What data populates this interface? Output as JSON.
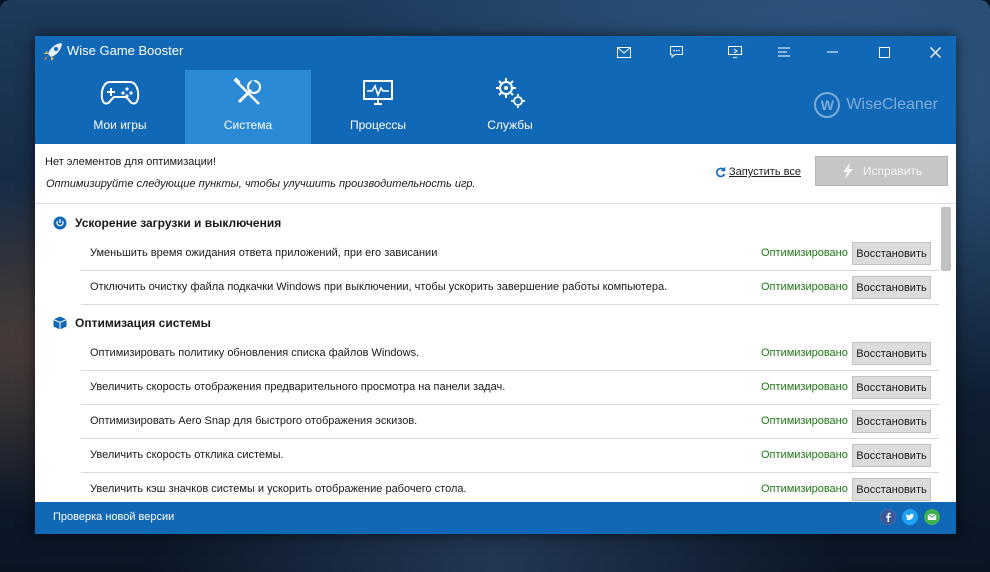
{
  "window": {
    "title": "Wise Game Booster"
  },
  "nav": {
    "tabs": [
      {
        "label": "Мои игры",
        "icon": "gamepad-icon"
      },
      {
        "label": "Система",
        "icon": "tools-icon"
      },
      {
        "label": "Процессы",
        "icon": "monitor-icon"
      },
      {
        "label": "Службы",
        "icon": "gears-icon"
      }
    ],
    "active_tab": "Система",
    "brand": "WiseCleaner",
    "brand_letter": "W"
  },
  "info": {
    "status": "Нет элементов для оптимизации!",
    "hint": "Оптимизируйте следующие пункты, чтобы улучшить производительность игр.",
    "run_all": "Запустить все",
    "fix_button": "Исправить"
  },
  "sections": [
    {
      "title": "Ускорение загрузки и выключения",
      "icon": "power-icon",
      "items": [
        {
          "text": "Уменьшить время ожидания ответа приложений, при его зависании",
          "state": "Оптимизировано",
          "action": "Восстановить"
        },
        {
          "text": "Отключить очистку файла подкачки Windows при выключении, чтобы ускорить завершение работы компьютера.",
          "state": "Оптимизировано",
          "action": "Восстановить"
        }
      ]
    },
    {
      "title": "Оптимизация системы",
      "icon": "cube-icon",
      "items": [
        {
          "text": "Оптимизировать политику обновления списка файлов Windows.",
          "state": "Оптимизировано",
          "action": "Восстановить"
        },
        {
          "text": "Увеличить скорость отображения предварительного просмотра на панели задач.",
          "state": "Оптимизировано",
          "action": "Восстановить"
        },
        {
          "text": "Оптимизировать Aero Snap для быстрого отображения эскизов.",
          "state": "Оптимизировано",
          "action": "Восстановить"
        },
        {
          "text": "Увеличить скорость отклика системы.",
          "state": "Оптимизировано",
          "action": "Восстановить"
        },
        {
          "text": "Увеличить кэш значков системы и ускорить отображение рабочего стола.",
          "state": "Оптимизировано",
          "action": "Восстановить"
        }
      ]
    }
  ],
  "footer": {
    "check_update": "Проверка новой версии",
    "social": [
      "facebook-icon",
      "twitter-icon",
      "email-icon"
    ]
  },
  "colors": {
    "brand_blue": "#1168b7",
    "active_tab": "#2b8ad6",
    "optimized_green": "#1f7a12"
  }
}
